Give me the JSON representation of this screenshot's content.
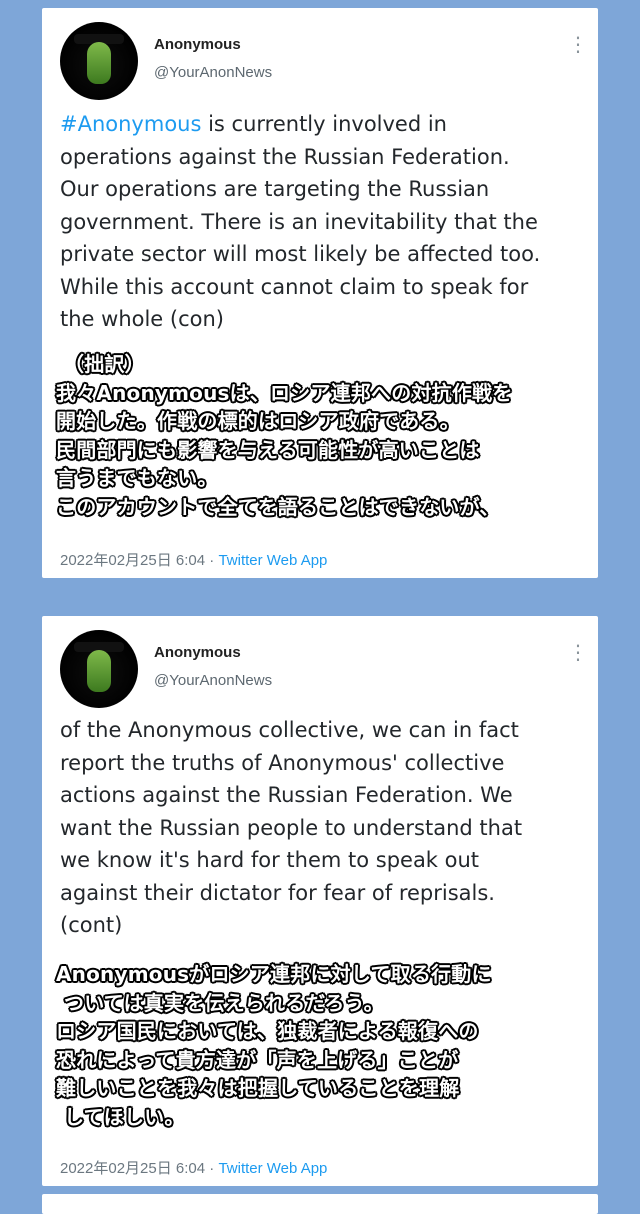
{
  "tweets": [
    {
      "author": {
        "name": "Anonymous",
        "handle": "@YourAnonNews"
      },
      "hashtag": "#Anonymous",
      "text_lines": [
        " is currently involved in",
        "operations against the Russian Federation.",
        "Our operations are targeting the Russian",
        "government. There is an inevitability that the",
        "private sector will most likely be affected too.",
        "While this account cannot claim to speak for",
        "the whole (con)"
      ],
      "translation_lines": [
        "（拙訳）",
        "我々Anonymousは、ロシア連邦への対抗作戦を",
        "開始した。作戦の標的はロシア政府である。",
        "民間部門にも影響を与える可能性が高いことは",
        "言うまでもない。",
        "このアカウントで全てを語ることはできないが、"
      ],
      "date": "2022年02月25日 6:04",
      "separator": " · ",
      "app": "Twitter Web App"
    },
    {
      "author": {
        "name": "Anonymous",
        "handle": "@YourAnonNews"
      },
      "text_lines": [
        "of the Anonymous collective, we can in fact",
        "report the truths of Anonymous' collective",
        "actions against the Russian Federation.  We",
        "want the Russian people to understand that",
        "we know it's hard for them to speak out",
        "against their dictator for fear of reprisals.",
        "(cont)"
      ],
      "translation_lines": [
        "Anonymousがロシア連邦に対して取る行動に",
        "ついては真実を伝えられるだろう。",
        "ロシア国民においては、独裁者による報復への",
        "恐れによって貴方達が「声を上げる」ことが",
        "難しいことを我々は把握していることを理解",
        "してほしい。"
      ],
      "date": "2022年02月25日 6:04",
      "separator": " · ",
      "app": "Twitter Web App"
    }
  ],
  "icons": {
    "more": "more-vertical-icon",
    "avatar": "anonymous-mask-avatar"
  },
  "colors": {
    "background": "#7ea6d8",
    "link": "#1d9bf0",
    "card": "#ffffff"
  }
}
